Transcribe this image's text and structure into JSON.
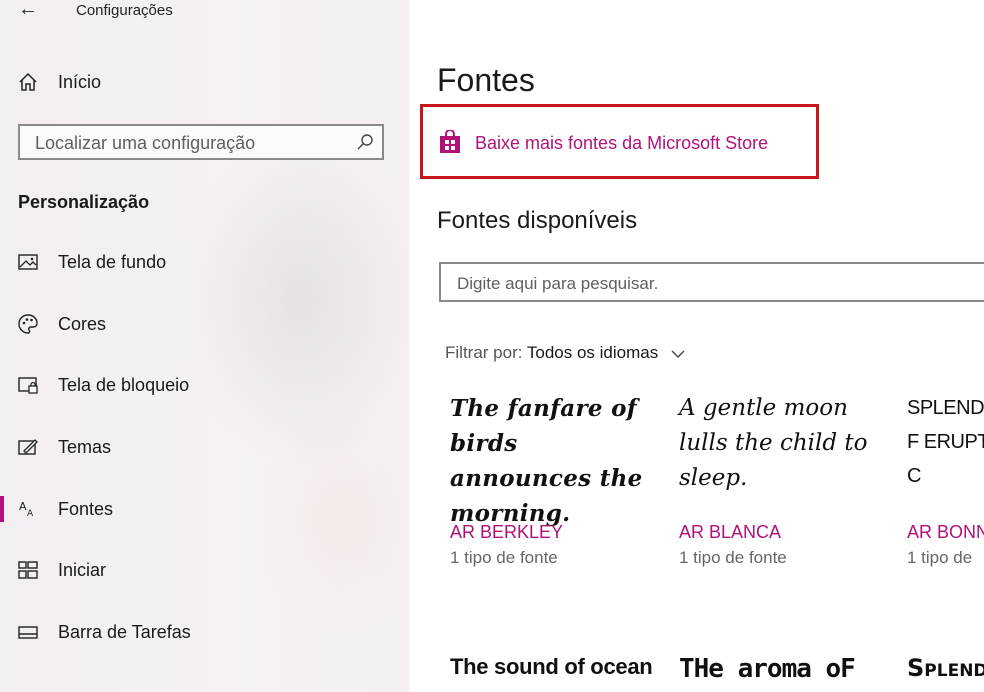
{
  "window": {
    "title": "Configurações"
  },
  "sidebar": {
    "home_label": "Início",
    "search_placeholder": "Localizar uma configuração",
    "section_title": "Personalização",
    "items": [
      {
        "label": "Tela de fundo",
        "icon": "picture-icon"
      },
      {
        "label": "Cores",
        "icon": "palette-icon"
      },
      {
        "label": "Tela de bloqueio",
        "icon": "lock-screen-icon"
      },
      {
        "label": "Temas",
        "icon": "themes-icon"
      },
      {
        "label": "Fontes",
        "icon": "fonts-icon",
        "active": true
      },
      {
        "label": "Iniciar",
        "icon": "start-icon"
      },
      {
        "label": "Barra de Tarefas",
        "icon": "taskbar-icon"
      }
    ]
  },
  "main": {
    "title": "Fontes",
    "store_link": "Baixe mais fontes da Microsoft Store",
    "available_title": "Fontes disponíveis",
    "search_placeholder": "Digite aqui para pesquisar.",
    "filter_label": "Filtrar por:",
    "filter_value": "Todos os idiomas",
    "fonts": [
      {
        "sample": "The fanfare of birds announces the morning.",
        "name": "AR BERKLEY",
        "count": "1 tipo de fonte"
      },
      {
        "sample": "A gentle moon lulls the child to sleep.",
        "name": "AR BLANCA",
        "count": "1 tipo de fonte"
      },
      {
        "sample": "SPLENDID F ERUPTED C",
        "name": "AR BONN",
        "count": "1 tipo de"
      }
    ],
    "next_row_samples": [
      "The sound of ocean",
      "THe aroma oF",
      "Splend"
    ]
  },
  "colors": {
    "accent": "#b0127a",
    "highlight_box": "#c8161d"
  }
}
